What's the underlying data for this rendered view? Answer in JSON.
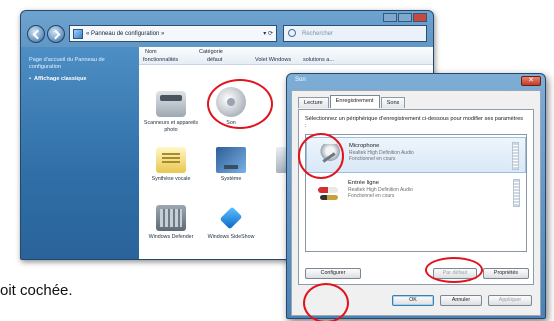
{
  "control_panel": {
    "address": "« Panneau de configuration »",
    "search_placeholder": "Rechercher",
    "left_panel": {
      "home_link": "Page d'accueil du Panneau de configuration",
      "classic_view": "Affichage classique"
    },
    "columns": {
      "name": "Nom",
      "category": "Catégorie",
      "sub_headers": [
        "fonctionnalités",
        "défaut",
        "Volet Windows",
        "solutions a..."
      ]
    },
    "items": [
      {
        "label": "Scanneurs et appareils photo",
        "icon": "scanner-icon"
      },
      {
        "label": "Son",
        "icon": "sound-icon"
      },
      {
        "label": "Synthèse vocale",
        "icon": "speech-icon"
      },
      {
        "label": "Système",
        "icon": "system-icon"
      },
      {
        "label": "Windows Defender",
        "icon": "defender-icon"
      },
      {
        "label": "Windows SideShow",
        "icon": "sideshow-icon"
      }
    ]
  },
  "sound_dialog": {
    "title": "Son",
    "close_label": "✕",
    "tabs": [
      "Lecture",
      "Enregistrement",
      "Sons"
    ],
    "active_tab": "Enregistrement",
    "instructions": "Sélectionnez un périphérique d'enregistrement ci-dessous pour modifier ses paramètres :",
    "devices": [
      {
        "name": "Microphone",
        "driver": "Realtek High Definition Audio",
        "status": "Fonctionnel en cours",
        "icon": "microphone-icon",
        "selected": true
      },
      {
        "name": "Entrée ligne",
        "driver": "Realtek High Definition Audio",
        "status": "Fonctionnel en cours",
        "icon": "line-in-icon",
        "selected": false
      }
    ],
    "buttons": {
      "configure": "Configurer",
      "set_default": "Par défaut",
      "properties": "Propriétés",
      "ok": "OK",
      "cancel": "Annuler",
      "apply": "Appliquer"
    }
  },
  "footer_text": "oit cochée.",
  "colors": {
    "annotation_circle": "#e0141e",
    "aero_blue": "#4b81b4"
  }
}
